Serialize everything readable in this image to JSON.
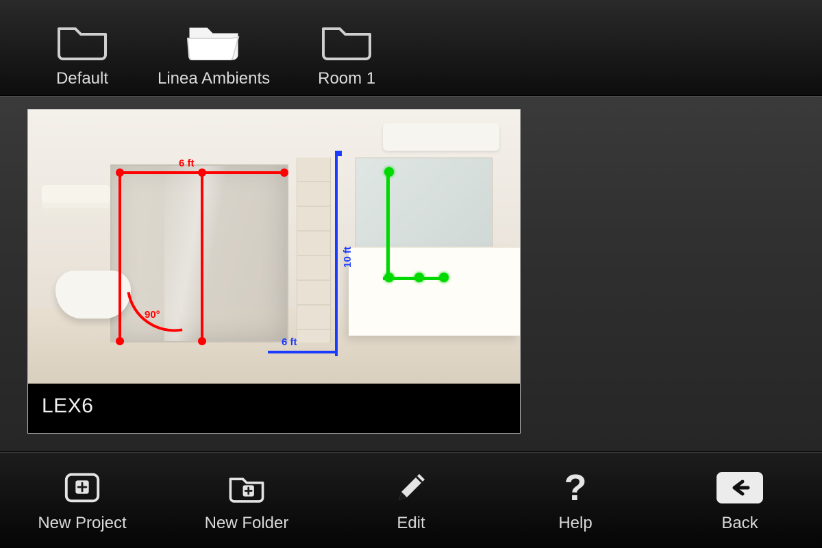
{
  "folders": [
    {
      "label": "Default",
      "active": false
    },
    {
      "label": "Linea Ambients",
      "active": true
    },
    {
      "label": "Room 1",
      "active": false
    }
  ],
  "project": {
    "title": "LEX6",
    "dimensions": {
      "height_label": "10 ft",
      "width_top_label": "6 ft",
      "width_bottom_label": "6 ft",
      "angle_label": "90°"
    }
  },
  "toolbar": {
    "new_project": "New Project",
    "new_folder": "New Folder",
    "edit": "Edit",
    "help": "Help",
    "back": "Back"
  },
  "colors": {
    "dim_blue": "#1a3bff",
    "dim_red": "#ff0000",
    "dim_green": "#00d900"
  }
}
